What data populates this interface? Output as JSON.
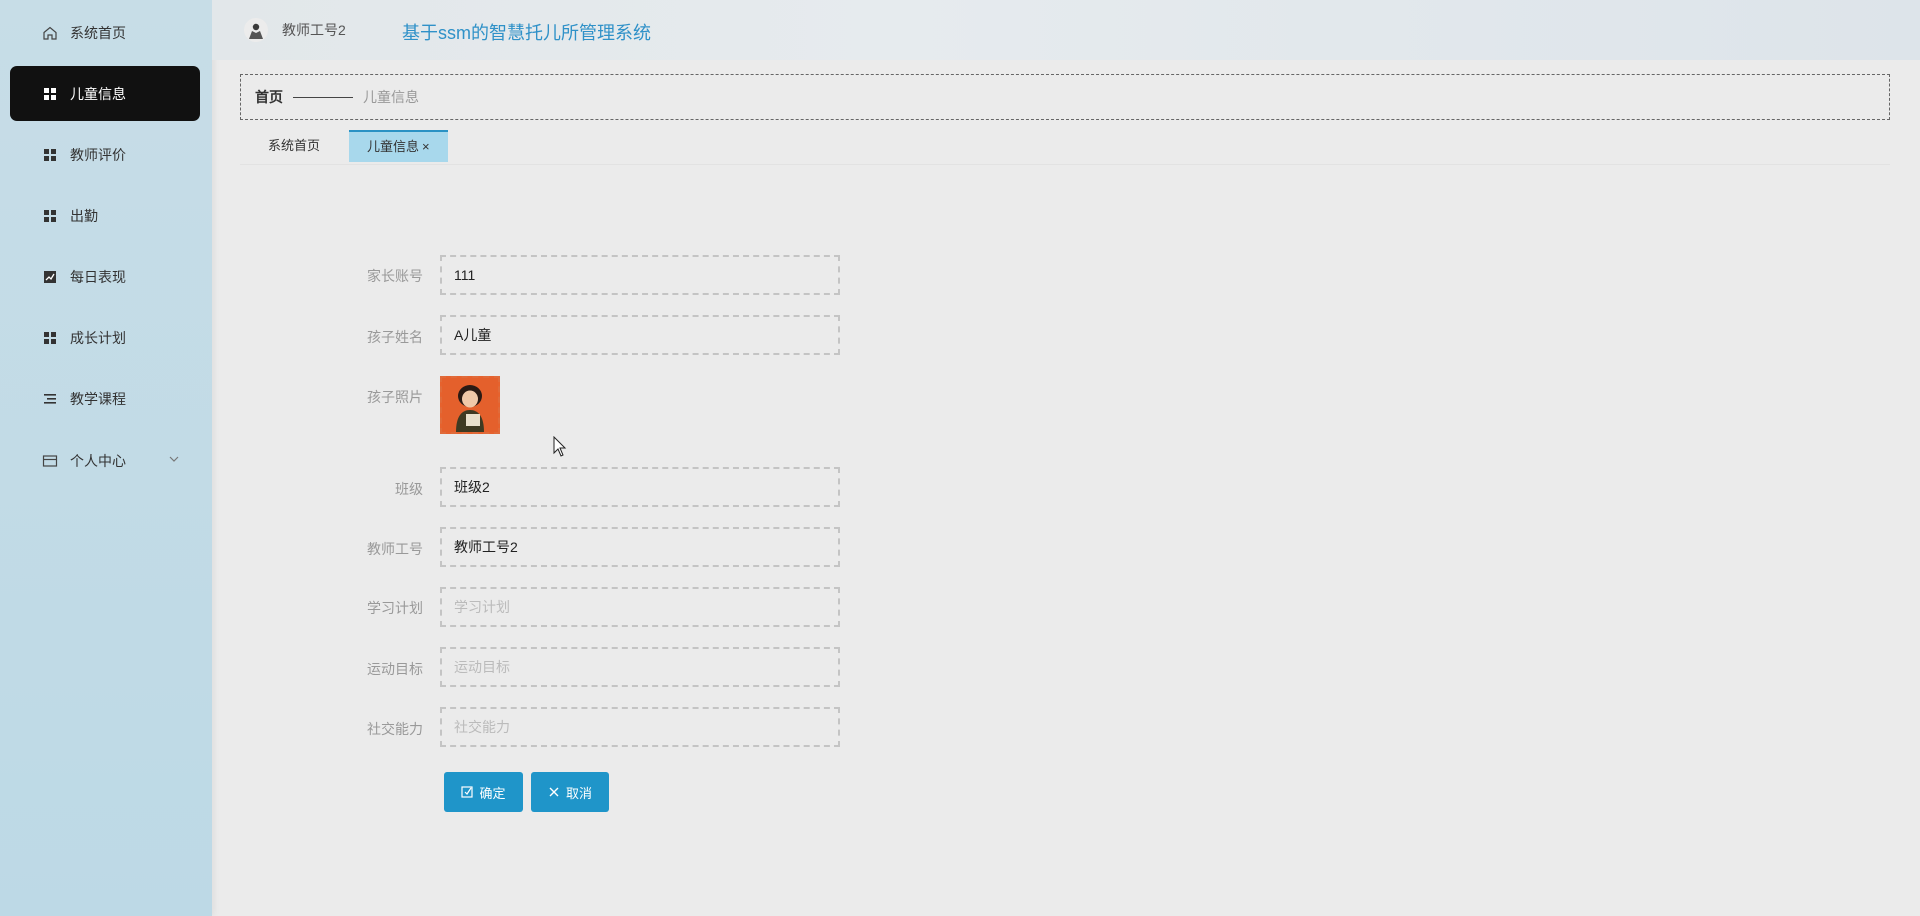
{
  "app": {
    "title": "基于ssm的智慧托儿所管理系统",
    "user": "教师工号2",
    "accent_color": "#2f91c8",
    "active_color": "#111111"
  },
  "sidebar": {
    "items": [
      {
        "label": "系统首页",
        "icon": "home-icon"
      },
      {
        "label": "儿童信息",
        "icon": "grid-icon",
        "active": true
      },
      {
        "label": "教师评价",
        "icon": "grid-icon"
      },
      {
        "label": "出勤",
        "icon": "grid-icon"
      },
      {
        "label": "每日表现",
        "icon": "chart-icon"
      },
      {
        "label": "成长计划",
        "icon": "grid-icon"
      },
      {
        "label": "教学课程",
        "icon": "list-icon"
      },
      {
        "label": "个人中心",
        "icon": "card-icon",
        "expandable": true
      }
    ]
  },
  "breadcrumb": {
    "home": "首页",
    "current": "儿童信息"
  },
  "tabs": [
    {
      "label": "系统首页"
    },
    {
      "label": "儿童信息",
      "active": true,
      "close": "×"
    }
  ],
  "form": {
    "parent_account": {
      "label": "家长账号",
      "value": "111"
    },
    "child_name": {
      "label": "孩子姓名",
      "value": "A儿童"
    },
    "child_photo": {
      "label": "孩子照片"
    },
    "class": {
      "label": "班级",
      "value": "班级2"
    },
    "teacher_id": {
      "label": "教师工号",
      "value": "教师工号2"
    },
    "study_plan": {
      "label": "学习计划",
      "value": "",
      "placeholder": "学习计划"
    },
    "sport_goal": {
      "label": "运动目标",
      "value": "",
      "placeholder": "运动目标"
    },
    "social_ability": {
      "label": "社交能力",
      "value": "",
      "placeholder": "社交能力"
    }
  },
  "buttons": {
    "confirm": "确定",
    "cancel": "取消"
  }
}
